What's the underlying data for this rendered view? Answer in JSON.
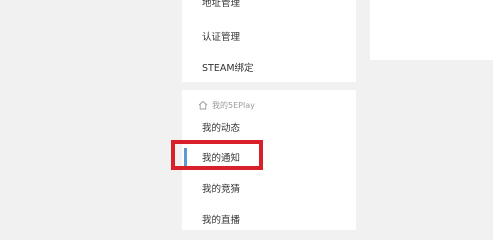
{
  "menu_top": {
    "items": [
      {
        "label": "地址管理"
      },
      {
        "label": "认证管理"
      },
      {
        "label": "STEAM绑定"
      }
    ]
  },
  "menu_section": {
    "header_label": "我的5EPlay",
    "header_icon": "home-icon",
    "items": [
      {
        "label": "我的动态"
      },
      {
        "label": "我的通知",
        "active": true
      },
      {
        "label": "我的竞猜"
      },
      {
        "label": "我的直播"
      }
    ]
  },
  "colors": {
    "background": "#f1f1f1",
    "panel": "#ffffff",
    "active_indicator": "#5b9bd5",
    "highlight_border": "#d81f2a",
    "header_text": "#9a9a9a"
  }
}
